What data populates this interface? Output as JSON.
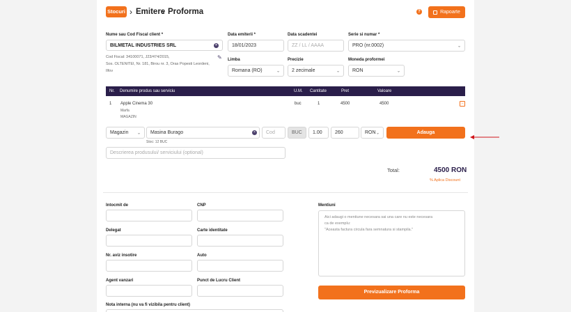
{
  "breadcrumb": {
    "badge": "Stocuri",
    "sep": "›",
    "item1": "Emitere",
    "item2": "Proforma"
  },
  "header": {
    "help_icon": "?",
    "reports_label": "Rapoarte"
  },
  "client": {
    "label": "Nume sau Cod Fiscal client *",
    "value": "BILMETAL INDUSTRIES SRL",
    "info_line1": "Cod Fiscal: 34100071, J23/474/2015,",
    "info_line2": "Sos. OLTENITEI, Nr. 181, Birou nr. 3, Oras Popesti Leordeni,",
    "info_line3": "Ilfov"
  },
  "fields": {
    "issue_date_label": "Data emiterii *",
    "issue_date_value": "18/01/2023",
    "due_date_label": "Data scadentei",
    "due_date_placeholder": "ZZ / LL / AAAA",
    "series_label": "Serie si numar *",
    "series_value": "PRO (nr.0002)",
    "language_label": "Limba",
    "language_value": "Romana (RO)",
    "precision_label": "Precizie",
    "precision_value": "2 zecimale",
    "currency_label": "Moneda proformei",
    "currency_value": "RON"
  },
  "table": {
    "headers": [
      "Nr.",
      "Denumire produs sau serviciu",
      "U.M.",
      "Cantitate",
      "Pret",
      "Valoare"
    ],
    "rows": [
      {
        "nr": "1",
        "name": "Apple Cinema 30",
        "sub1": "Marfa",
        "sub2": "MAGAZIN",
        "um": "buc",
        "qty": "1",
        "price": "4500",
        "value": "4500"
      }
    ]
  },
  "add_row": {
    "warehouse": "Magazin",
    "product": "Masina Burago",
    "code_placeholder": "Cod",
    "um": "BUC",
    "qty": "1.00",
    "price": "260",
    "currency": "RON",
    "add_label": "Adauga",
    "stock_note": "Stoc: 12 BUC",
    "description_placeholder": "Descrierea produsului/ serviciului (optional)"
  },
  "totals": {
    "label": "Total:",
    "value": "4500 RON",
    "discount_link": "% Aplica Discount"
  },
  "bottom": {
    "issued_by_label": "Intocmit de",
    "cnp_label": "CNP",
    "delegate_label": "Delegat",
    "id_card_label": "Carte identitate",
    "notice_label": "Nr. aviz insotire",
    "auto_label": "Auto",
    "agent_label": "Agent vanzari",
    "workpoint_label": "Punct de Lucru Client",
    "internal_note_label": "Nota interna (nu va fi vizibila pentru client)",
    "mentions_label": "Mentiuni",
    "mentions_placeholder_1": "Aici adaugi o mentiune necesara sai una care nu este necesara",
    "mentions_placeholder_2": "ca de exemplu:",
    "mentions_placeholder_3": "\"Aceasta factura circula fara semnatura si stampila.\"",
    "preview_label": "Previzualizare Proforma"
  },
  "colors": {
    "accent": "#f2711c",
    "table_header": "#2a1e4a",
    "total": "#2a1e4a",
    "arrow": "#d0161b"
  }
}
